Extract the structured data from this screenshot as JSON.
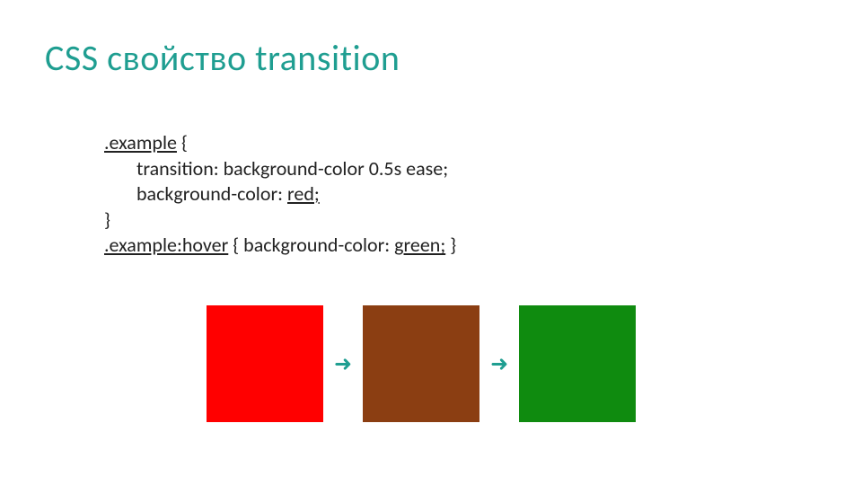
{
  "title": "CSS свойство transition",
  "code": {
    "line1_selector": ".example",
    "line1_brace": " {",
    "line2_indent": "    ",
    "line2_prop": "transition: ",
    "line2_value": "background-color 0.5s ease;",
    "line3_indent": "    ",
    "line3_prop": "background-color: ",
    "line3_value": "red;",
    "line4": "}",
    "line5_selector": ".example:hover",
    "line5_brace_open": " { ",
    "line5_prop": "background-color: ",
    "line5_value": "green;",
    "line5_brace_close": " }"
  },
  "demo": {
    "color1": "#ff0000",
    "color2": "#8b3e12",
    "color3": "#0f8b0f",
    "arrow_glyph": "➜",
    "arrow_color": "#1f9e91"
  }
}
